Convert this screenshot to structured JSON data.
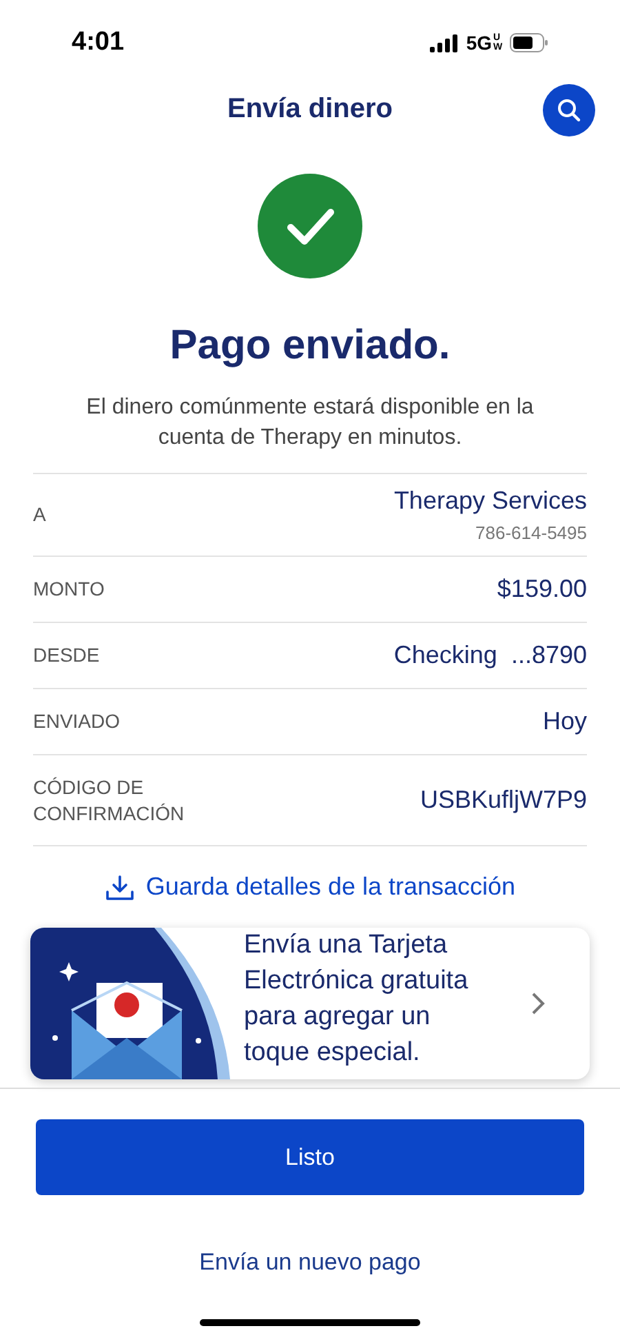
{
  "status_bar": {
    "time": "4:01",
    "network": "5G",
    "network_badge": "UW"
  },
  "header": {
    "title": "Envía dinero"
  },
  "confirmation": {
    "title": "Pago enviado.",
    "message": "El dinero comúnmente estará disponible en la cuenta de Therapy en minutos."
  },
  "details": [
    {
      "label": "A",
      "value": "Therapy Services",
      "sub": "786-614-5495"
    },
    {
      "label": "MONTO",
      "value": "$159.00"
    },
    {
      "label": "DESDE",
      "value": "Checking  ...8790"
    },
    {
      "label": "ENVIADO",
      "value": "Hoy"
    },
    {
      "label": "CÓDIGO DE CONFIRMACIÓN",
      "value": "USBKufljW7P9"
    }
  ],
  "save_link": "Guarda detalles de la transacción",
  "promo_card": {
    "text": "Envía una Tarjeta Electrónica gratuita para agregar un toque especial.",
    "kind": "picture"
  },
  "primary_button": "Listo",
  "secondary_link": "Envía un nuevo pago"
}
